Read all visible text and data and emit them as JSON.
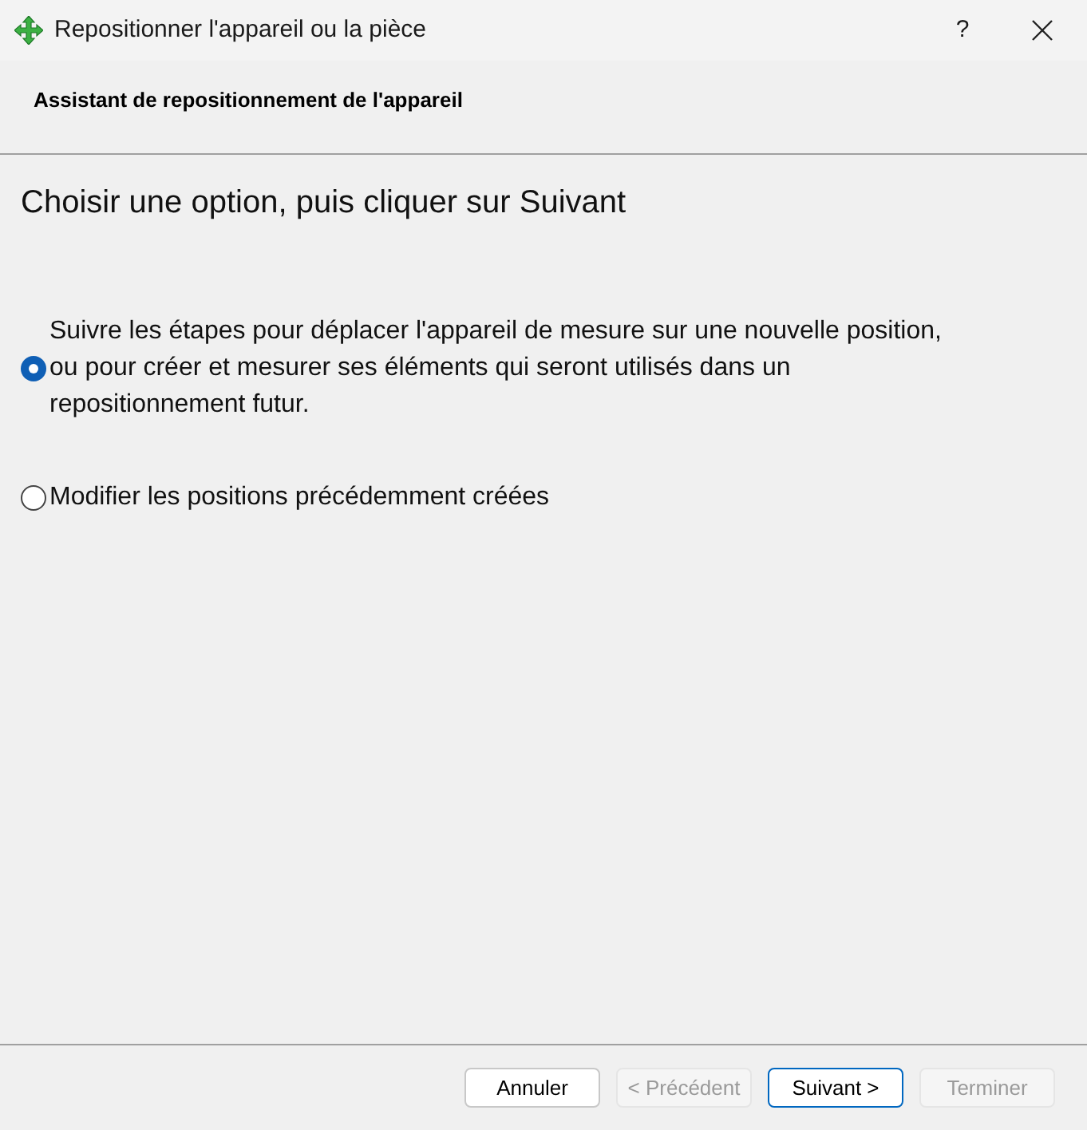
{
  "window": {
    "title": "Repositionner l'appareil ou la pièce",
    "help": "?"
  },
  "header": {
    "title": "Assistant de repositionnement de l'appareil"
  },
  "instruction": "Choisir une option, puis cliquer sur Suivant",
  "options": [
    {
      "label": "Suivre les étapes pour déplacer l'appareil de mesure sur une nouvelle position, ou pour créer et mesurer ses éléments qui seront utilisés dans un repositionnement futur.",
      "selected": true
    },
    {
      "label": "Modifier les positions précédemment créées",
      "selected": false
    }
  ],
  "buttons": [
    {
      "label": "Annuler",
      "disabled": false,
      "default": false
    },
    {
      "label": "< Précédent",
      "disabled": true,
      "default": false
    },
    {
      "label": "Suivant >",
      "disabled": false,
      "default": true
    },
    {
      "label": "Terminer",
      "disabled": true,
      "default": false
    }
  ]
}
